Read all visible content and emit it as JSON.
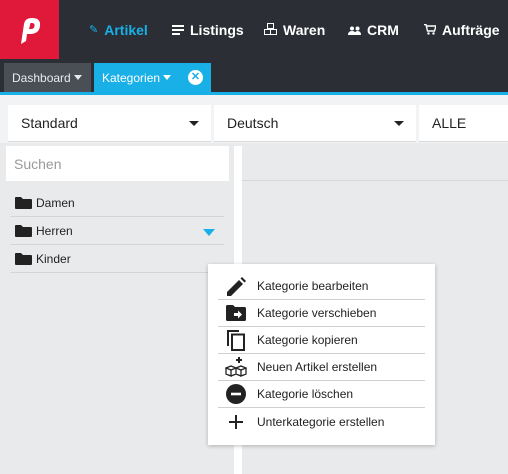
{
  "topnav": {
    "items": [
      {
        "label": "Artikel",
        "icon": "tag-icon",
        "active": true
      },
      {
        "label": "Listings",
        "icon": "list-icon"
      },
      {
        "label": "Waren",
        "icon": "boxes-icon"
      },
      {
        "label": "CRM",
        "icon": "people-icon"
      },
      {
        "label": "Aufträge",
        "icon": "cart-icon"
      }
    ]
  },
  "tabs": {
    "dashboard": "Dashboard",
    "kategorien": "Kategorien"
  },
  "filters": {
    "view": "Standard",
    "language": "Deutsch",
    "scope": "ALLE"
  },
  "search": {
    "placeholder": "Suchen"
  },
  "tree": {
    "items": [
      {
        "label": "Damen"
      },
      {
        "label": "Herren"
      },
      {
        "label": "Kinder"
      }
    ]
  },
  "context_menu": {
    "items": [
      {
        "label": "Kategorie bearbeiten",
        "icon": "pencil-icon"
      },
      {
        "label": "Kategorie verschieben",
        "icon": "folder-move-icon"
      },
      {
        "label": "Kategorie kopieren",
        "icon": "copy-icon"
      },
      {
        "label": "Neuen Artikel erstellen",
        "icon": "new-item-boxes-icon"
      },
      {
        "label": "Kategorie löschen",
        "icon": "minus-circle-icon"
      },
      {
        "label": "Unterkategorie erstellen",
        "icon": "plus-icon"
      }
    ]
  },
  "colors": {
    "brand": "#e0183a",
    "accent": "#18b0e6",
    "topbar": "#2b2f35"
  }
}
